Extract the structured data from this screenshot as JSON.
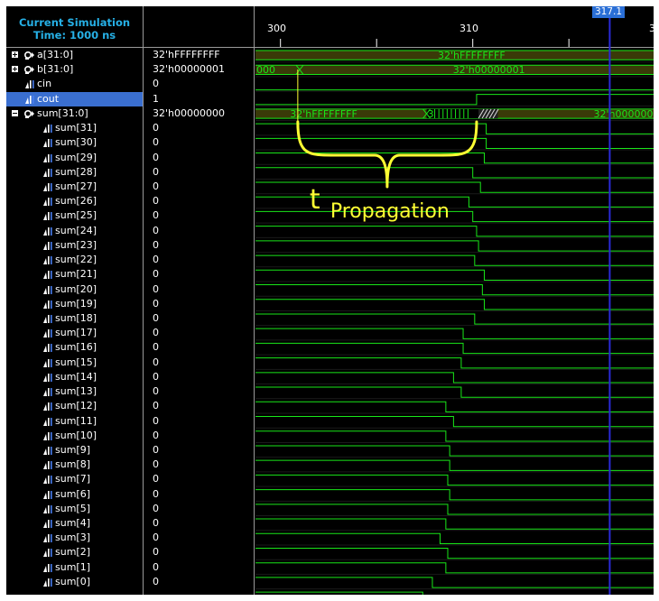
{
  "simulation": {
    "title_line1": "Current Simulation",
    "title_line2": "Time: 1000 ns"
  },
  "timeline": {
    "ticks": [
      "300",
      "310",
      "3"
    ],
    "cursor_label": "317.1"
  },
  "signals": [
    {
      "name": "a[31:0]",
      "value": "32'hFFFFFFFF",
      "type": "bus",
      "expander": "plus"
    },
    {
      "name": "b[31:0]",
      "value": "32'h00000001",
      "type": "bus",
      "expander": "plus"
    },
    {
      "name": "cin",
      "value": "0",
      "type": "bit"
    },
    {
      "name": "cout",
      "value": "1",
      "type": "bit",
      "selected": true
    },
    {
      "name": "sum[31:0]",
      "value": "32'h00000000",
      "type": "bus",
      "expander": "minus"
    },
    {
      "name": "sum[31]",
      "value": "0",
      "type": "bit",
      "indent": true
    },
    {
      "name": "sum[30]",
      "value": "0",
      "type": "bit",
      "indent": true
    },
    {
      "name": "sum[29]",
      "value": "0",
      "type": "bit",
      "indent": true
    },
    {
      "name": "sum[28]",
      "value": "0",
      "type": "bit",
      "indent": true
    },
    {
      "name": "sum[27]",
      "value": "0",
      "type": "bit",
      "indent": true
    },
    {
      "name": "sum[26]",
      "value": "0",
      "type": "bit",
      "indent": true
    },
    {
      "name": "sum[25]",
      "value": "0",
      "type": "bit",
      "indent": true
    },
    {
      "name": "sum[24]",
      "value": "0",
      "type": "bit",
      "indent": true
    },
    {
      "name": "sum[23]",
      "value": "0",
      "type": "bit",
      "indent": true
    },
    {
      "name": "sum[22]",
      "value": "0",
      "type": "bit",
      "indent": true
    },
    {
      "name": "sum[21]",
      "value": "0",
      "type": "bit",
      "indent": true
    },
    {
      "name": "sum[20]",
      "value": "0",
      "type": "bit",
      "indent": true
    },
    {
      "name": "sum[19]",
      "value": "0",
      "type": "bit",
      "indent": true
    },
    {
      "name": "sum[18]",
      "value": "0",
      "type": "bit",
      "indent": true
    },
    {
      "name": "sum[17]",
      "value": "0",
      "type": "bit",
      "indent": true
    },
    {
      "name": "sum[16]",
      "value": "0",
      "type": "bit",
      "indent": true
    },
    {
      "name": "sum[15]",
      "value": "0",
      "type": "bit",
      "indent": true
    },
    {
      "name": "sum[14]",
      "value": "0",
      "type": "bit",
      "indent": true
    },
    {
      "name": "sum[13]",
      "value": "0",
      "type": "bit",
      "indent": true
    },
    {
      "name": "sum[12]",
      "value": "0",
      "type": "bit",
      "indent": true
    },
    {
      "name": "sum[11]",
      "value": "0",
      "type": "bit",
      "indent": true
    },
    {
      "name": "sum[10]",
      "value": "0",
      "type": "bit",
      "indent": true
    },
    {
      "name": "sum[9]",
      "value": "0",
      "type": "bit",
      "indent": true
    },
    {
      "name": "sum[8]",
      "value": "0",
      "type": "bit",
      "indent": true
    },
    {
      "name": "sum[7]",
      "value": "0",
      "type": "bit",
      "indent": true
    },
    {
      "name": "sum[6]",
      "value": "0",
      "type": "bit",
      "indent": true
    },
    {
      "name": "sum[5]",
      "value": "0",
      "type": "bit",
      "indent": true
    },
    {
      "name": "sum[4]",
      "value": "0",
      "type": "bit",
      "indent": true
    },
    {
      "name": "sum[3]",
      "value": "0",
      "type": "bit",
      "indent": true
    },
    {
      "name": "sum[2]",
      "value": "0",
      "type": "bit",
      "indent": true
    },
    {
      "name": "sum[1]",
      "value": "0",
      "type": "bit",
      "indent": true
    },
    {
      "name": "sum[0]",
      "value": "0",
      "type": "bit",
      "indent": true
    }
  ],
  "waves": {
    "a_label": "32'hFFFFFFFF",
    "b_label_left": "000",
    "b_label_right": "32'h00000001",
    "sum_label_left": "32'hFFFFFFFF",
    "sum_label_mid": "3",
    "sum_label_right": "32'h00000000",
    "cout_transition_ns": 310.2,
    "bit_transitions_ns": [
      310.7,
      310.7,
      310.6,
      310.0,
      310.4,
      309.8,
      310.0,
      310.2,
      310.3,
      310.1,
      310.6,
      310.5,
      310.6,
      310.1,
      309.5,
      309.5,
      309.4,
      309.0,
      309.4,
      308.6,
      309.0,
      308.6,
      308.8,
      308.8,
      308.7,
      308.8,
      308.7,
      308.6,
      308.3,
      308.7,
      308.6,
      307.9,
      307.4
    ]
  },
  "annotation": {
    "label_t": "t",
    "label_propagation": "Propagation",
    "color": "#ffff33"
  },
  "colors": {
    "wave": "#19e619",
    "bus_fill": "#3a3a08",
    "cursor": "#2a2ad8",
    "panel_divider": "#9a9a9a",
    "selected_row": "#3a6fd0",
    "header_text": "#26b0e6"
  }
}
